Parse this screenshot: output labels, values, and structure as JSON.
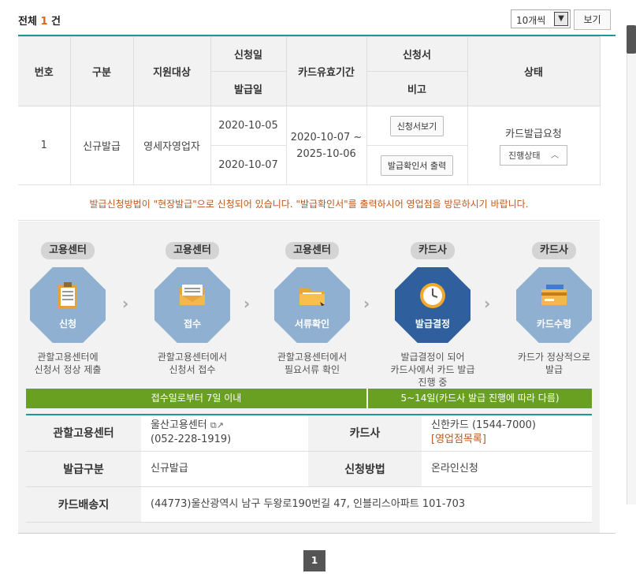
{
  "header": {
    "total_prefix": "전체",
    "total_count": "1",
    "total_suffix": "건",
    "page_size": "10개씩",
    "view_button": "보기"
  },
  "table": {
    "headers": {
      "no": "번호",
      "type": "구분",
      "target": "지원대상",
      "apply_date": "신청일",
      "issue_date": "발급일",
      "validity": "카드유효기간",
      "application": "신청서",
      "remarks": "비고",
      "status": "상태"
    },
    "row": {
      "no": "1",
      "type": "신규발급",
      "target": "영세자영업자",
      "apply_date": "2020-10-05",
      "issue_date": "2020-10-07",
      "validity_from": "2020-10-07 ~",
      "validity_to": "2025-10-06",
      "view_application": "신청서보기",
      "print_confirmation": "발급확인서 출력",
      "status_text": "카드발급요청",
      "progress_dropdown": "진행상태"
    }
  },
  "notice": "발급신청방법이 \"현장발급\"으로 신청되어 있습니다. \"발급확인서\"를 출력하시어 영업점을 방문하시기 바랍니다.",
  "steps": [
    {
      "category": "고용센터",
      "label": "신청",
      "desc1": "관할고용센터에",
      "desc2": "신청서 정상 제출",
      "desc3": "",
      "icon": "clipboard-icon",
      "active": false
    },
    {
      "category": "고용센터",
      "label": "접수",
      "desc1": "관할고용센터에서",
      "desc2": "신청서 접수",
      "desc3": "",
      "icon": "envelope-icon",
      "active": false
    },
    {
      "category": "고용센터",
      "label": "서류확인",
      "desc1": "관할고용센터에서",
      "desc2": "필요서류 확인",
      "desc3": "",
      "icon": "folder-icon",
      "active": false
    },
    {
      "category": "카드사",
      "label": "발급결정",
      "desc1": "발급결정이 되어",
      "desc2": "카드사에서 카드 발급",
      "desc3": "진행 중",
      "icon": "clock-icon",
      "active": true
    },
    {
      "category": "카드사",
      "label": "카드수령",
      "desc1": "카드가 정상적으로",
      "desc2": "발급",
      "desc3": "",
      "icon": "card-icon",
      "active": false
    }
  ],
  "bars": {
    "left": "접수일로부터 7일 이내",
    "right": "5~14일(카드사 발급 진행에 따라 다름)"
  },
  "info": {
    "center_label": "관할고용센터",
    "center_name": "울산고용센터",
    "center_phone": "(052-228-1919)",
    "card_label": "카드사",
    "card_name": "신한카드 (1544-7000)",
    "branch_link": "[영업점목록]",
    "issue_type_label": "발급구분",
    "issue_type": "신규발급",
    "method_label": "신청방법",
    "method": "온라인신청",
    "delivery_label": "카드배송지",
    "delivery": "(44773)울산광역시 남구 두왕로190번길 47, 인블리스아파트 101-703"
  },
  "pagination": {
    "current": "1"
  },
  "colors": {
    "teal": "#1a9a97",
    "green": "#6aa021",
    "hex_inactive": "#8fb0d1",
    "hex_active": "#2f5f9c",
    "notice": "#c0571b"
  }
}
